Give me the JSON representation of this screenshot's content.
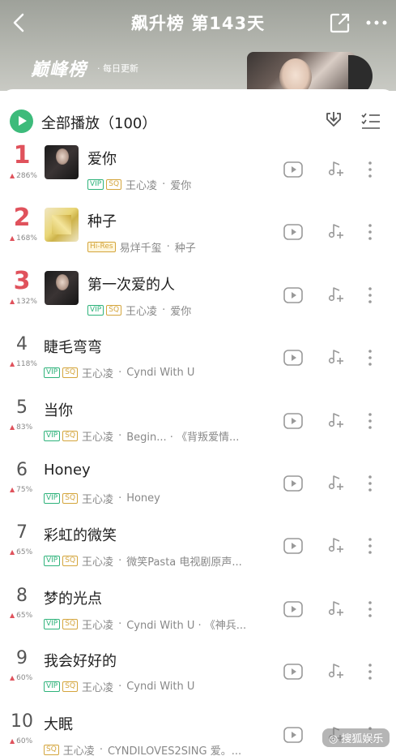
{
  "header": {
    "title": "飙升榜 第143天",
    "logo_text": "巅峰榜",
    "daily_update": "· 每日更新"
  },
  "toolbar": {
    "play_all_label": "全部播放（100）"
  },
  "songs": [
    {
      "rank": "1",
      "trend": "286%",
      "title": "爱你",
      "tags": [
        "VIP",
        "SQ"
      ],
      "artist": "王心凌",
      "album": "爱你",
      "thumb": "dark"
    },
    {
      "rank": "2",
      "trend": "168%",
      "title": "种子",
      "tags": [
        "Hi-Res"
      ],
      "artist": "易烊千玺",
      "album": "种子",
      "thumb": "gold"
    },
    {
      "rank": "3",
      "trend": "132%",
      "title": "第一次爱的人",
      "tags": [
        "VIP",
        "SQ"
      ],
      "artist": "王心凌",
      "album": "爱你",
      "thumb": "dark"
    },
    {
      "rank": "4",
      "trend": "118%",
      "title": "睫毛弯弯",
      "tags": [
        "VIP",
        "SQ"
      ],
      "artist": "王心凌",
      "album": "Cyndi With U"
    },
    {
      "rank": "5",
      "trend": "83%",
      "title": "当你",
      "tags": [
        "VIP",
        "SQ"
      ],
      "artist": "王心凌",
      "album": "Begin... · 《背叛爱情..."
    },
    {
      "rank": "6",
      "trend": "75%",
      "title": "Honey",
      "tags": [
        "VIP",
        "SQ"
      ],
      "artist": "王心凌",
      "album": "Honey"
    },
    {
      "rank": "7",
      "trend": "65%",
      "title": "彩虹的微笑",
      "tags": [
        "VIP",
        "SQ"
      ],
      "artist": "王心凌",
      "album": "微笑Pasta 电视剧原声..."
    },
    {
      "rank": "8",
      "trend": "65%",
      "title": "梦的光点",
      "tags": [
        "VIP",
        "SQ"
      ],
      "artist": "王心凌",
      "album": "Cyndi With U · 《神兵..."
    },
    {
      "rank": "9",
      "trend": "60%",
      "title": "我会好好的",
      "tags": [
        "VIP",
        "SQ"
      ],
      "artist": "王心凌",
      "album": "Cyndi With U"
    },
    {
      "rank": "10",
      "trend": "60%",
      "title": "大眠",
      "tags": [
        "SQ"
      ],
      "artist": "王心凌",
      "album": "CYNDILOVES2SING 爱。..."
    }
  ],
  "watermark": "搜狐娱乐",
  "colors": {
    "accent_green": "#3dbb7b",
    "rank_red": "#e0525c",
    "vip_green": "#2fb37b",
    "sq_gold": "#d4a53c"
  },
  "icons": [
    "back-icon",
    "share-icon",
    "more-icon",
    "play-icon",
    "download-icon",
    "multiselect-icon",
    "video-icon",
    "add-to-playlist-icon",
    "more-vertical-icon"
  ]
}
